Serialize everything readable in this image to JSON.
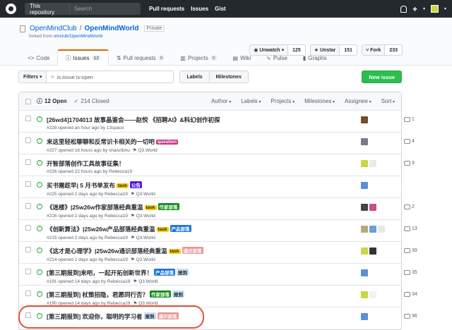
{
  "header": {
    "search_scope": "This repository",
    "search_placeholder": "Search",
    "nav": [
      "Pull requests",
      "Issues",
      "Gist"
    ]
  },
  "repo": {
    "owner": "OpenMindClub",
    "name": "OpenMindWorld",
    "visibility": "Private",
    "forked_prefix": "forked from ",
    "forked_from": "omclub/OpenMindWorld",
    "unwatch_label": "Unwatch",
    "unwatch_count": "125",
    "unstar_label": "Unstar",
    "unstar_count": "151",
    "fork_label": "Fork",
    "fork_count": "233"
  },
  "tabs": [
    {
      "label": "Code",
      "count": ""
    },
    {
      "label": "Issues",
      "count": "12"
    },
    {
      "label": "Pull requests",
      "count": "0"
    },
    {
      "label": "Projects",
      "count": "0"
    },
    {
      "label": "Wiki",
      "count": ""
    },
    {
      "label": "Pulse",
      "count": ""
    },
    {
      "label": "Graphs",
      "count": ""
    }
  ],
  "filters": {
    "filters_label": "Filters",
    "query": "is:issue is:open",
    "labels_button": "Labels",
    "milestones_button": "Milestones",
    "new_issue": "New issue"
  },
  "list_header": {
    "open": "12 Open",
    "closed": "214 Closed",
    "menus": [
      "Author",
      "Labels",
      "Projects",
      "Milestones",
      "Assignee",
      "Sort"
    ]
  },
  "issues": [
    {
      "title": "[26wd4]1704013 故事晶鉴会——赵悦 《招聘AI》&科幻创作初探",
      "meta": "#228 opened an hour ago by 13space",
      "milestone": "",
      "labels": [],
      "comments": "1"
    },
    {
      "title": "来这里轻松聊聊和反常识卡相关的一切吧",
      "meta": "#227 opened 16 hours ago by shanzibnu",
      "milestone": "Q3.World",
      "labels": [
        {
          "text": "question",
          "color": "#cc317c"
        }
      ],
      "comments": "4"
    },
    {
      "title": "开智部落创作工具故事征集！",
      "meta": "#226 opened 22 hours ago by Rebecca19",
      "milestone": "",
      "labels": [],
      "comments": "3"
    },
    {
      "title": "买书需趁早| 5 月书单发布",
      "meta": "#225 opened 2 days ago by Rebecca19",
      "milestone": "Q3.World",
      "labels": [
        {
          "text": "task",
          "color": "#fbca04"
        },
        {
          "text": "公告",
          "color": "#5319e7"
        }
      ],
      "comments": ""
    },
    {
      "title": "《迷楼》|25w26w作家部落经典重温",
      "meta": "#216 opened 2 days ago by Rebecca19",
      "milestone": "Q3.World",
      "labels": [
        {
          "text": "task",
          "color": "#fbca04"
        },
        {
          "text": "作家部落",
          "color": "#0e8a16"
        }
      ],
      "comments": "2"
    },
    {
      "title": "《创新算法》|25w26w产品部落经典重温",
      "meta": "#215 opened 2 days ago by Rebecca19",
      "milestone": "Q3.World",
      "labels": [
        {
          "text": "task",
          "color": "#fbca04"
        },
        {
          "text": "产品部落",
          "color": "#1d76db"
        }
      ],
      "comments": "13"
    },
    {
      "title": "《这才是心理学》|25w26w通识部落经典重温",
      "meta": "#214 opened 2 days ago by Rebecca19",
      "milestone": "Q3.World",
      "labels": [
        {
          "text": "task",
          "color": "#fbca04"
        },
        {
          "text": "通识部落",
          "color": "#e99695"
        }
      ],
      "comments": "39"
    },
    {
      "title": "[第三期报到]来吧，一起开拓创新世界！",
      "meta": "#191 opened 14 days ago by Rebecca19",
      "milestone": "Q3.World",
      "labels": [
        {
          "text": "产品部落",
          "color": "#1d76db"
        },
        {
          "text": "报到",
          "color": "#c5def5"
        }
      ],
      "comments": "35"
    },
    {
      "title": "[第三期报到] 杖策招隐，君愿同行否？",
      "meta": "#190 opened 14 days ago by Rebecca19",
      "milestone": "Q3.World",
      "labels": [
        {
          "text": "作家部落",
          "color": "#0e8a16"
        },
        {
          "text": "报到",
          "color": "#c5def5"
        }
      ],
      "comments": "34"
    },
    {
      "title": "[第三期报到] 欢迎你，聪明的学习者",
      "meta": "",
      "milestone": "",
      "labels": [
        {
          "text": "报到",
          "color": "#c5def5"
        },
        {
          "text": "通识部落",
          "color": "#e99695"
        }
      ],
      "comments": "96"
    }
  ],
  "colors": {
    "accent_tab": "#e36209",
    "open_green": "#28a745",
    "new_issue_green": "#2cbe4e",
    "highlight_circle": "#e94f37"
  }
}
